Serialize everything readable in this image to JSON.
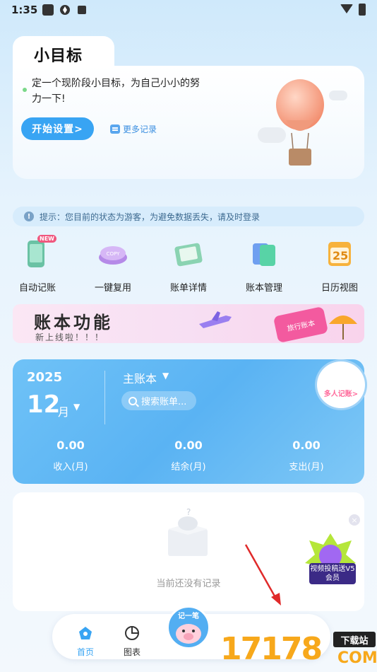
{
  "status_bar": {
    "time": "1:35"
  },
  "goal": {
    "title": "小目标",
    "description": "定一个现阶段小目标，为自己小小的努力一下!",
    "start_button": "开始设置>",
    "more_link": "更多记录"
  },
  "tip": {
    "text": "提示：您目前的状态为游客，为避免数据丢失，请及时登录"
  },
  "features": [
    {
      "label": "自动记账",
      "icon": "phone-icon"
    },
    {
      "label": "一键复用",
      "icon": "copy-button-icon"
    },
    {
      "label": "账单详情",
      "icon": "bill-icon"
    },
    {
      "label": "账本管理",
      "icon": "books-icon"
    },
    {
      "label": "日历视图",
      "icon": "calendar-icon"
    }
  ],
  "new_badge": "NEW",
  "calendar_day": "25",
  "banner": {
    "title": "账本功能",
    "subtitle": "新上线啦！！！",
    "tag": "旅行账本"
  },
  "account": {
    "year": "2025",
    "month": "12",
    "month_suffix": "月",
    "book_name": "主账本",
    "search_placeholder": "搜索账单...",
    "multi_badge": "多人记账>",
    "stats": [
      {
        "value": "0.00",
        "label": "收入(月)"
      },
      {
        "value": "0.00",
        "label": "结余(月)"
      },
      {
        "value": "0.00",
        "label": "支出(月)"
      }
    ]
  },
  "empty": {
    "text": "当前还没有记录"
  },
  "promo": {
    "label": "视频投稿送V5会员"
  },
  "tabs": [
    {
      "label": "首页",
      "active": true
    },
    {
      "label": "图表",
      "active": false
    }
  ],
  "record_button": "记一笔",
  "watermark": {
    "number": "17178",
    "tag": "下载站",
    "domain": "COM"
  },
  "colors": {
    "accent": "#38a4f3",
    "card": "#5ab3f3",
    "watermark": "#f7a81b"
  }
}
